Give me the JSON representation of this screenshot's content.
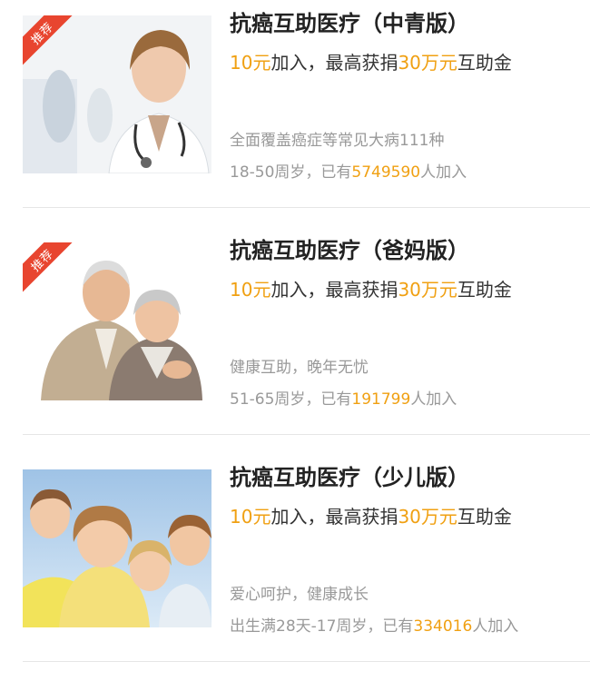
{
  "badge_label": "推荐",
  "colors": {
    "accent": "#f0a012",
    "badge": "#e8452f",
    "divider": "#e6e6e6"
  },
  "cards": [
    {
      "title": "抗癌互助医疗（中青版）",
      "fee": "10元",
      "join_text": "加入，最高获捐",
      "amount": "30万元",
      "benefit": "互助金",
      "desc": "全面覆盖癌症等常见大病111种",
      "age": "18-50周岁，已有",
      "members": "5749590",
      "suffix": "人加入",
      "recommended": true,
      "image_icon": "doctor-photo"
    },
    {
      "title": "抗癌互助医疗（爸妈版）",
      "fee": "10元",
      "join_text": "加入，最高获捐",
      "amount": "30万元",
      "benefit": "互助金",
      "desc": "健康互助，晚年无忧",
      "age": "51-65周岁，已有",
      "members": "191799",
      "suffix": "人加入",
      "recommended": true,
      "image_icon": "elderly-couple-photo"
    },
    {
      "title": "抗癌互助医疗（少儿版）",
      "fee": "10元",
      "join_text": "加入，最高获捐",
      "amount": "30万元",
      "benefit": "互助金",
      "desc": "爱心呵护，健康成长",
      "age": "出生满28天-17周岁，已有",
      "members": "334016",
      "suffix": "人加入",
      "recommended": false,
      "image_icon": "children-photo"
    }
  ]
}
